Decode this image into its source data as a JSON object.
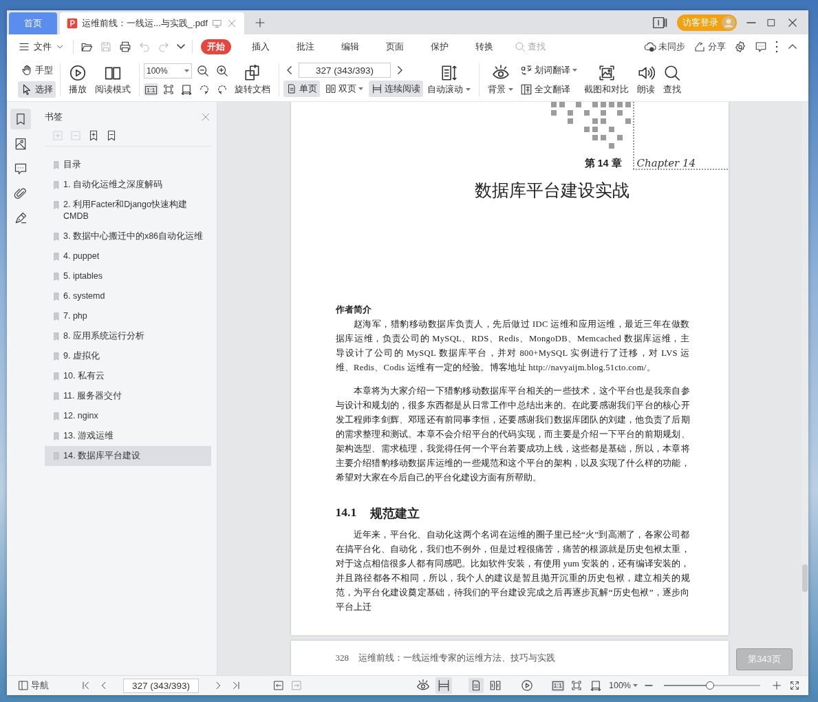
{
  "tabs": [
    {
      "label": "首页",
      "kind": "home",
      "selected": false
    },
    {
      "label": "运维前线：一线运...与实践_.pdf",
      "kind": "document",
      "selected": true
    }
  ],
  "title_bar": {
    "account_label": "访客登录"
  },
  "menu": {
    "file_label": "文件",
    "quick_tools": [
      {
        "disabled": false
      },
      {
        "disabled": true
      },
      {
        "disabled": false
      },
      {
        "disabled": true
      },
      {
        "disabled": true
      },
      {
        "disabled": false
      }
    ],
    "items": [
      {
        "label": "开始",
        "selected": true
      },
      {
        "label": "插入",
        "selected": false
      },
      {
        "label": "批注",
        "selected": false
      },
      {
        "label": "编辑",
        "selected": false
      },
      {
        "label": "页面",
        "selected": false
      },
      {
        "label": "保护",
        "selected": false
      },
      {
        "label": "转换",
        "selected": false
      }
    ],
    "search_placeholder": "查找",
    "sync_label": "未同步",
    "share_label": "分享"
  },
  "toolbar": {
    "hand_tool": {
      "label": "手型",
      "selected": false
    },
    "select_tool": {
      "label": "选择",
      "selected": true
    },
    "play": {
      "label": "播放"
    },
    "read_mode": {
      "label": "阅读模式"
    },
    "zoom": {
      "value": "100%"
    },
    "actual_size": {
      "label": "1:1",
      "selected": true
    },
    "rotate_document": {
      "label": "旋转文档"
    },
    "page_field": {
      "value": "327 (343/393)"
    },
    "single_page": {
      "label": "单页",
      "selected": true
    },
    "double_page": {
      "label": "双页",
      "selected": false
    },
    "continuous": {
      "label": "连续阅读",
      "selected": true
    },
    "auto_scroll": {
      "label": "自动滚动"
    },
    "background": {
      "label": "背景"
    },
    "word_translate": {
      "label": "划词翻译"
    },
    "full_translate": {
      "label": "全文翻译"
    },
    "screenshot_compare": {
      "label": "截图和对比"
    },
    "read_aloud": {
      "label": "朗读"
    },
    "find": {
      "label": "查找"
    }
  },
  "sidebar": {
    "rail": [
      {
        "selected": true
      },
      {
        "selected": false
      },
      {
        "selected": false
      },
      {
        "selected": false
      },
      {
        "selected": false
      }
    ],
    "title": "书签",
    "tools": [
      {
        "disabled": true
      },
      {
        "disabled": true
      },
      {
        "disabled": false
      },
      {
        "disabled": false
      }
    ],
    "bookmarks": [
      {
        "label": "目录",
        "selected": false
      },
      {
        "label": "1. 自动化运维之深度解码",
        "selected": false
      },
      {
        "label": "2. 利用Facter和Django快速构建CMDB",
        "selected": false
      },
      {
        "label": "3. 数据中心搬迁中的x86自动化运维",
        "selected": false
      },
      {
        "label": "4. puppet",
        "selected": false
      },
      {
        "label": "5. iptables",
        "selected": false
      },
      {
        "label": "6. systemd",
        "selected": false
      },
      {
        "label": "7. php",
        "selected": false
      },
      {
        "label": "8. 应用系统运行分析",
        "selected": false
      },
      {
        "label": "9. 虚拟化",
        "selected": false
      },
      {
        "label": "10. 私有云",
        "selected": false
      },
      {
        "label": "11. 服务器交付",
        "selected": false
      },
      {
        "label": "12. nginx",
        "selected": false
      },
      {
        "label": "13. 游戏运维",
        "selected": false
      },
      {
        "label": "14. 数据库平台建设",
        "selected": true
      }
    ]
  },
  "document": {
    "chapter_label": "第 14 章",
    "chapter_script": "Chapter 14",
    "title": "数据库平台建设实战",
    "author_heading": "作者简介",
    "author_bio": "赵海军，猎豹移动数据库负责人，先后做过 IDC 运维和应用运维，最近三年在做数据库运维，负责公司的 MySQL、RDS、Redis、MongoDB、Memcached 数据库运维，主导设计了公司的 MySQL 数据库平台，并对 800+MySQL 实例进行了迁移，对 LVS 运维、Redis、Codis 运维有一定的经验。博客地址 http://navyaijm.blog.51cto.com/。",
    "intro": "本章将为大家介绍一下猎豹移动数据库平台相关的一些技术，这个平台也是我亲自参与设计和规划的，很多东西都是从日常工作中总结出来的。在此要感谢我们平台的核心开发工程师李剑辉、邓瑶还有前同事李恒，还要感谢我们数据库团队的刘建，他负责了后期的需求整理和测试。本章不会介绍平台的代码实现，而主要是介绍一下平台的前期规划、架构选型、需求梳理，我觉得任何一个平台若要成功上线，这些都是基础，所以，本章将主要介绍猎豹移动数据库运维的一些规范和这个平台的架构，以及实现了什么样的功能，希望对大家在今后自己的平台化建设方面有所帮助。",
    "section": {
      "number": "14.1",
      "title": "规范建立"
    },
    "section_text": "近年来，平台化、自动化这两个名词在运维的圈子里已经“火”到高潮了，各家公司都在搞平台化、自动化，我们也不例外，但是过程很痛苦，痛苦的根源就是历史包袱太重，对于这点相信很多人都有同感吧。比如软件安装，有使用 yum 安装的，还有编译安装的，并且路径都各不相同，所以，我个人的建议是暂且抛开沉重的历史包袱，建立相关的规范，为平台化建设奠定基础，待我们的平台建设完成之后再逐步瓦解“历史包袱”，逐步向平台上迁",
    "next_page_number": "328",
    "next_page_header": "运维前线：一线运维专家的运维方法、技巧与实践",
    "page_badge": "第343页"
  },
  "status_bar": {
    "nav_label": "导航",
    "page_field": "327 (343/393)",
    "continuous": {
      "selected": true
    },
    "single_page": {
      "selected": true
    },
    "double_page": {
      "selected": false
    },
    "actual_size": {
      "label": "1:1",
      "selected": true
    },
    "zoom": "100%",
    "zoom_slider": {
      "level": 0.48
    }
  }
}
